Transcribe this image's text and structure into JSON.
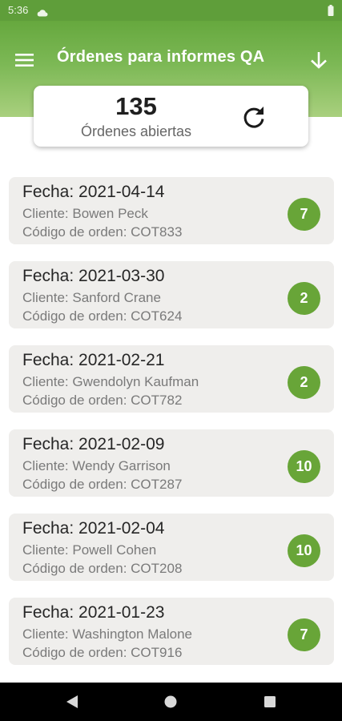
{
  "status_bar": {
    "time": "5:36"
  },
  "app_bar": {
    "title": "Órdenes para informes QA",
    "menu_icon": "hamburger-menu-icon",
    "download_icon": "download-arrow-icon"
  },
  "summary": {
    "count": "135",
    "label": "Órdenes abiertas",
    "refresh_icon": "refresh-icon"
  },
  "orders": [
    {
      "date": "Fecha: 2021-04-14",
      "client": "Cliente: Bowen Peck",
      "code": "Código de orden: COT833",
      "count": "7"
    },
    {
      "date": "Fecha: 2021-03-30",
      "client": "Cliente: Sanford Crane",
      "code": "Código de orden: COT624",
      "count": "2"
    },
    {
      "date": "Fecha: 2021-02-21",
      "client": "Cliente: Gwendolyn Kaufman",
      "code": "Código de orden: COT782",
      "count": "2"
    },
    {
      "date": "Fecha: 2021-02-09",
      "client": "Cliente: Wendy Garrison",
      "code": "Código de orden: COT287",
      "count": "10"
    },
    {
      "date": "Fecha: 2021-02-04",
      "client": "Cliente: Powell Cohen",
      "code": "Código de orden: COT208",
      "count": "10"
    },
    {
      "date": "Fecha: 2021-01-23",
      "client": "Cliente: Washington Malone",
      "code": "Código de orden: COT916",
      "count": "7"
    }
  ],
  "colors": {
    "primary_green": "#68a538",
    "app_bar_top": "#66a83e",
    "card_background": "#efeeec"
  }
}
